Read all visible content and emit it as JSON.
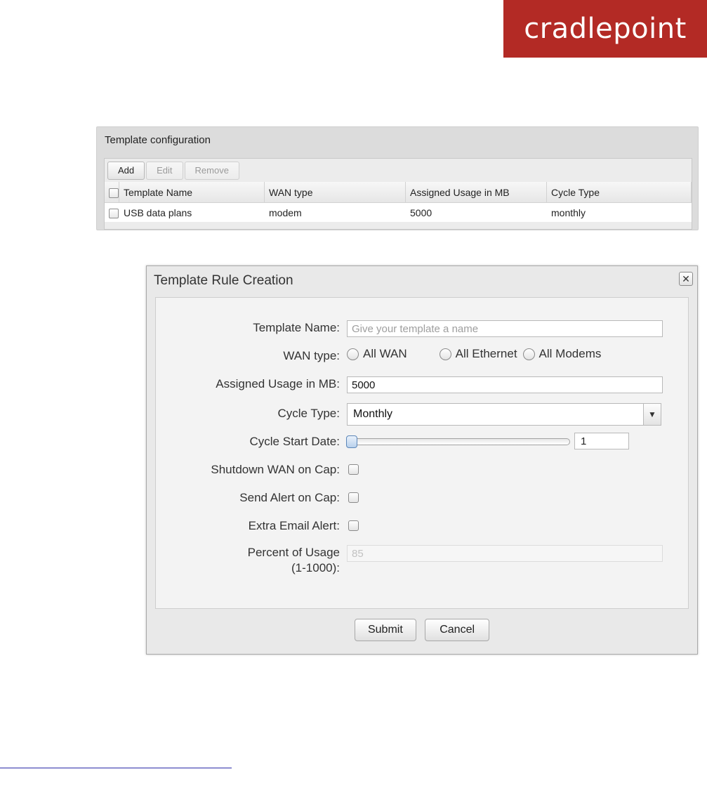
{
  "logo": {
    "text": "cradlepoint"
  },
  "config": {
    "title": "Template configuration",
    "toolbar": {
      "add": "Add",
      "edit": "Edit",
      "remove": "Remove"
    },
    "columns": [
      "Template Name",
      "WAN type",
      "Assigned Usage in MB",
      "Cycle Type"
    ],
    "rows": [
      {
        "name": "USB data plans",
        "wan_type": "modem",
        "usage": "5000",
        "cycle": "monthly"
      }
    ]
  },
  "dialog": {
    "title": "Template Rule Creation",
    "close": "X",
    "template_name": {
      "label": "Template Name:",
      "placeholder": "Give your template a name"
    },
    "wan_type": {
      "label": "WAN type:",
      "options": [
        "All WAN",
        "All Ethernet",
        "All Modems"
      ]
    },
    "usage": {
      "label": "Assigned Usage in MB:",
      "value": "5000"
    },
    "cycle_type": {
      "label": "Cycle Type:",
      "value": "Monthly"
    },
    "cycle_start": {
      "label": "Cycle Start Date:",
      "value": "1"
    },
    "shutdown": {
      "label": "Shutdown WAN on Cap:"
    },
    "send_alert": {
      "label": "Send Alert on Cap:"
    },
    "extra_email": {
      "label": "Extra Email Alert:"
    },
    "percent": {
      "label_line1": "Percent of Usage",
      "label_line2": "(1-1000):",
      "value": "85"
    },
    "buttons": {
      "submit": "Submit",
      "cancel": "Cancel"
    }
  }
}
